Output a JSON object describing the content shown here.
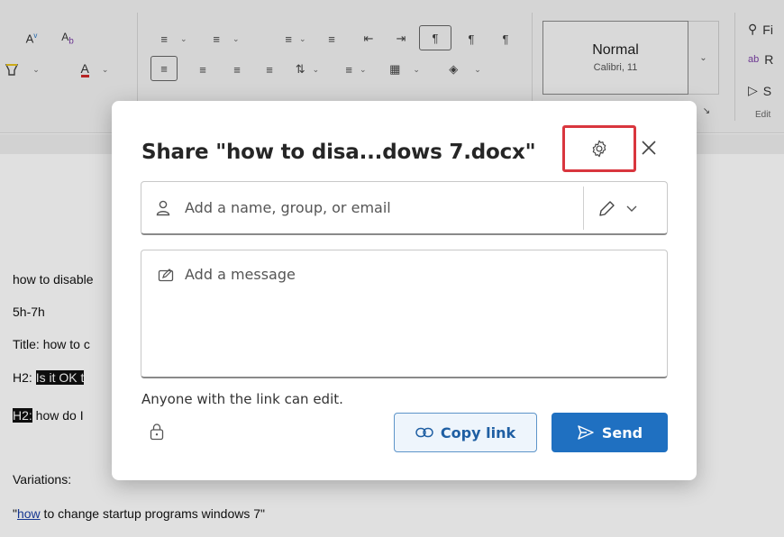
{
  "ribbon": {
    "style_gallery": {
      "name": "Normal",
      "font": "Calibri, 11"
    },
    "editing": {
      "find": "Fi",
      "replace": "R",
      "select": "S",
      "group_label": "Edit"
    }
  },
  "document": {
    "lines": [
      {
        "text": "how to disable"
      },
      {
        "text": "5h-7h"
      },
      {
        "text": "Title: how to c"
      },
      {
        "prefix": "H2: ",
        "highlight": "Is it OK t"
      },
      {
        "highlight": "H2:",
        "text": " how do I"
      },
      {
        "text": "Variations:"
      },
      {
        "open_quote": "\"",
        "link": "how",
        "text": " to change startup programs windows 7\""
      }
    ]
  },
  "dialog": {
    "title": "Share \"how to disa...dows 7.docx\"",
    "recipient_placeholder": "Add a name, group, or email",
    "message_placeholder": "Add a message",
    "link_info": "Anyone with the link can edit.",
    "copy_link_label": "Copy link",
    "send_label": "Send",
    "highlight_color": "#d9363e",
    "accent_color": "#1f70c1"
  },
  "icons": [
    "font-grow-icon",
    "spell-icon",
    "highlighter-icon",
    "font-color-icon",
    "bullets-icon",
    "numbering-icon",
    "multilevel-icon",
    "decrease-indent-icon",
    "increase-indent-icon",
    "pilcrow-icon",
    "align-left-icon",
    "center-icon",
    "align-right-icon",
    "justify-icon",
    "line-spacing-icon",
    "shading-icon",
    "borders-icon",
    "search-icon",
    "replace-icon",
    "select-icon",
    "gear-icon",
    "close-icon",
    "person-icon",
    "pencil-icon",
    "chevron-down-icon",
    "message-icon",
    "lock-icon",
    "link-icon",
    "send-icon"
  ]
}
